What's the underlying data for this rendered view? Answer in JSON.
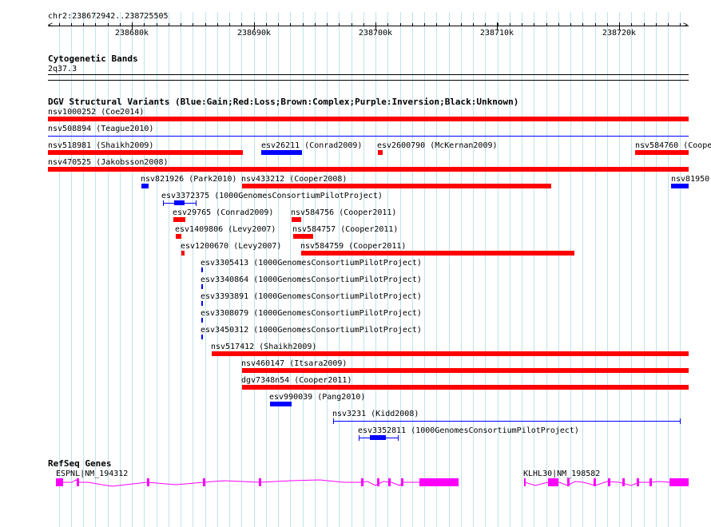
{
  "ruler": {
    "location": "chr2:238672942..238725505",
    "ticks": [
      "238680k",
      "238690k",
      "238700k",
      "238710k",
      "238720k"
    ]
  },
  "cytoband": {
    "title": "Cytogenetic Bands",
    "band": "2q37.3"
  },
  "dgv": {
    "title": "DGV Structural Variants (Blue:Gain;Red:Loss;Brown:Complex;Purple:Inversion;Black:Unknown)",
    "colors": {
      "loss": "#ff0000",
      "gain": "#0000ff"
    },
    "features": [
      {
        "label": "nsv1000252 (Coe2014)"
      },
      {
        "label": "nsv508894 (Teague2010)"
      },
      {
        "label": "nsv518981 (Shaikh2009)"
      },
      {
        "label": "esv26211 (Conrad2009)"
      },
      {
        "label": "esv2600790 (McKernan2009)"
      },
      {
        "label": "nsv584760 (Coope"
      },
      {
        "label": "nsv470525 (Jakobsson2008)"
      },
      {
        "label": "nsv821926 (Park2010)"
      },
      {
        "label": "nsv433212 (Cooper2008)"
      },
      {
        "label": "nsv81950"
      },
      {
        "label": "esv3372375 (1000GenomesConsortiumPilotProject)"
      },
      {
        "label": "esv29765 (Conrad2009)"
      },
      {
        "label": "nsv584756 (Cooper2011)"
      },
      {
        "label": "esv1409806 (Levy2007)"
      },
      {
        "label": "nsv584757 (Cooper2011)"
      },
      {
        "label": "esv1200670 (Levy2007)"
      },
      {
        "label": "nsv584759 (Cooper2011)"
      },
      {
        "label": "esv3305413 (1000GenomesConsortiumPilotProject)"
      },
      {
        "label": "esv3340864 (1000GenomesConsortiumPilotProject)"
      },
      {
        "label": "esv3393891 (1000GenomesConsortiumPilotProject)"
      },
      {
        "label": "esv3308079 (1000GenomesConsortiumPilotProject)"
      },
      {
        "label": "esv3450312 (1000GenomesConsortiumPilotProject)"
      },
      {
        "label": "nsv517412 (Shaikh2009)"
      },
      {
        "label": "nsv460147 (Itsara2009)"
      },
      {
        "label": "dgv7348n54 (Cooper2011)"
      },
      {
        "label": "esv990039 (Pang2010)"
      },
      {
        "label": "nsv3231 (Kidd2008)"
      },
      {
        "label": "esv3352811 (1000GenomesConsortiumPilotProject)"
      }
    ]
  },
  "refseq": {
    "title": "RefSeq Genes",
    "color": "#ff00ff",
    "genes": [
      {
        "label": "ESPNL|NM_194312"
      },
      {
        "label": "KLHL30|NM_198582"
      }
    ]
  }
}
